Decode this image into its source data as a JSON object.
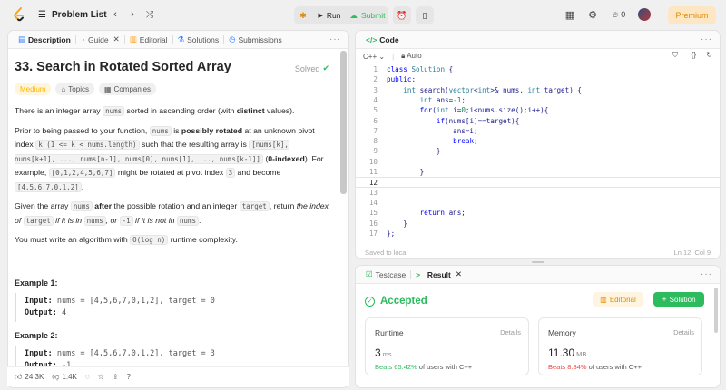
{
  "nav": {
    "problem_list": "Problem List",
    "run": "Run",
    "submit": "Submit",
    "streak": "0",
    "premium": "Premium"
  },
  "desc_tabs": [
    "Description",
    "Guide",
    "Editorial",
    "Solutions",
    "Submissions"
  ],
  "problem": {
    "title": "33. Search in Rotated Sorted Array",
    "solved": "Solved",
    "difficulty": "Medium",
    "topics": "Topics",
    "companies": "Companies",
    "p1_a": "There is an integer array ",
    "p1_code": "nums",
    "p1_b": " sorted in ascending order (with ",
    "p1_bold": "distinct",
    "p1_c": " values).",
    "p2_a": "Prior to being passed to your function, ",
    "p2_code1": "nums",
    "p2_b": " is ",
    "p2_bold1": "possibly rotated",
    "p2_c": " at an unknown pivot index ",
    "p2_code2": "k (1 <= k < nums.length)",
    "p2_d": " such that the resulting array is ",
    "p2_code3": "[nums[k], nums[k+1], ..., nums[n-1], nums[0], nums[1], ..., nums[k-1]]",
    "p2_e": " (",
    "p2_bold2": "0-indexed",
    "p2_f": "). For example, ",
    "p2_code4": "[0,1,2,4,5,6,7]",
    "p2_g": " might be rotated at pivot index ",
    "p2_code5": "3",
    "p2_h": " and become ",
    "p2_code6": "[4,5,6,7,0,1,2]",
    "p2_i": ".",
    "p3_a": "Given the array ",
    "p3_code1": "nums",
    "p3_bold": "after",
    "p3_b": " the possible rotation and an integer ",
    "p3_code2": "target",
    "p3_c": ", return ",
    "p3_it1": "the index of ",
    "p3_code3": "target",
    "p3_it2": " if it is in ",
    "p3_code4": "nums",
    "p3_it3": ", or ",
    "p3_code5": "-1",
    "p3_it4": " if it is not in ",
    "p3_code6": "nums",
    "p3_d": ".",
    "p4_a": "You must write an algorithm with ",
    "p4_code": "O(log n)",
    "p4_b": " runtime complexity.",
    "examples": [
      {
        "heading": "Example 1:",
        "input_label": "Input:",
        "input": " nums = [4,5,6,7,0,1,2], target = 0",
        "output_label": "Output:",
        "output": " 4"
      },
      {
        "heading": "Example 2:",
        "input_label": "Input:",
        "input": " nums = [4,5,6,7,0,1,2], target = 3",
        "output_label": "Output:",
        "output": " -1"
      }
    ],
    "likes": "24.3K",
    "dislikes": "1.4K"
  },
  "editor": {
    "tab": "Code",
    "language": "C++",
    "mode": "Auto",
    "saved": "Saved to local",
    "position": "Ln 12, Col 9"
  },
  "code_lines": [
    "class Solution {",
    "public:",
    "    int search(vector<int>& nums, int target) {",
    "        int ans=-1;",
    "        for(int i=0;i<nums.size();i++){",
    "            if(nums[i]==target){",
    "                ans=i;",
    "                break;",
    "            }",
    "",
    "        }",
    "",
    "",
    "",
    "        return ans;",
    "    }",
    "};"
  ],
  "result": {
    "tab_testcase": "Testcase",
    "tab_result": "Result",
    "status": "Accepted",
    "editorial": "Editorial",
    "solution": "Solution",
    "runtime": {
      "label": "Runtime",
      "details": "Details",
      "value": "3",
      "unit": "ms",
      "beats_pct": "Beats 65.42%",
      "beats_tail": " of users with C++"
    },
    "memory": {
      "label": "Memory",
      "details": "Details",
      "value": "11.30",
      "unit": "MB",
      "beats_pct": "Beats 8.84%",
      "beats_tail": " of users with C++"
    }
  },
  "colors": {
    "accent": "#ffa116",
    "success": "#2cbb5d",
    "bad": "#ef4743"
  }
}
